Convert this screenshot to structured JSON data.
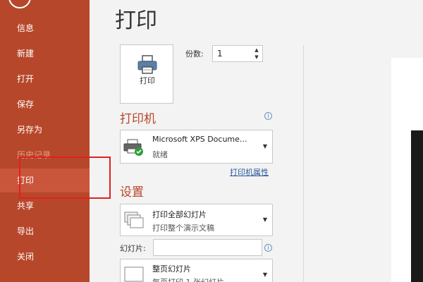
{
  "sidebar": {
    "items": [
      {
        "label": "信息"
      },
      {
        "label": "新建"
      },
      {
        "label": "打开"
      },
      {
        "label": "保存"
      },
      {
        "label": "另存为"
      },
      {
        "label": "历史记录"
      },
      {
        "label": "打印"
      },
      {
        "label": "共享"
      },
      {
        "label": "导出"
      },
      {
        "label": "关闭"
      }
    ],
    "active_index": 6,
    "color": "#b7472a"
  },
  "main": {
    "title": "打印",
    "print_button_label": "打印",
    "copies_label": "份数:",
    "copies_value": "1",
    "printer_section_title": "打印机",
    "printer": {
      "name": "Microsoft XPS Docume...",
      "status": "就绪"
    },
    "printer_properties_link": "打印机属性",
    "settings_section_title": "设置",
    "print_range": {
      "title": "打印全部幻灯片",
      "subtitle": "打印整个演示文稿"
    },
    "slides_label": "幻灯片:",
    "slides_value": "",
    "layout": {
      "title": "整页幻灯片",
      "subtitle": "每页打印 1 张幻灯片"
    }
  }
}
